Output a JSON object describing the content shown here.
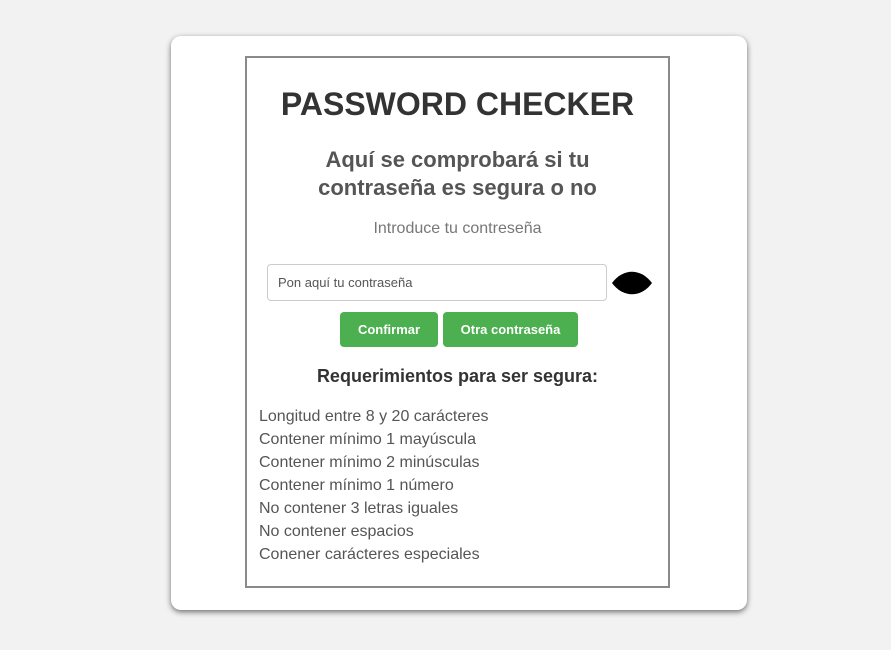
{
  "header": {
    "title": "PASSWORD CHECKER",
    "subtitle": "Aquí se comprobará si tu contraseña es segura o no"
  },
  "form": {
    "prompt": "Introduce tu contreseña",
    "password_placeholder": "Pon aquí tu contraseña",
    "password_value": "",
    "eye_icon": "eye-icon",
    "confirm_label": "Confirmar",
    "other_label": "Otra contraseña"
  },
  "requirements": {
    "title": "Requerimientos para ser segura:",
    "items": [
      "Longitud entre 8 y 20 carácteres",
      "Contener mínimo 1 mayúscula",
      "Contener mínimo 2 minúsculas",
      "Contener mínimo 1 número",
      "No contener 3 letras iguales",
      "No contener espacios",
      "Conener carácteres especiales"
    ]
  },
  "colors": {
    "page_background": "#f2f2f2",
    "card_background": "#ffffff",
    "button": "#4caf50",
    "button_text": "#ffffff",
    "title_text": "#333333"
  }
}
